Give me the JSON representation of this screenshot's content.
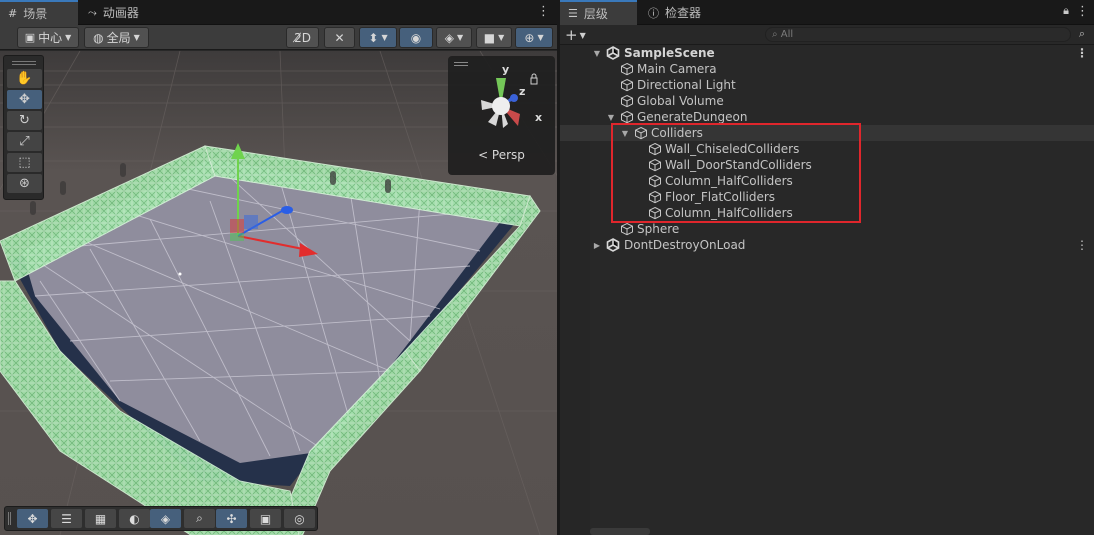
{
  "scene_panel": {
    "tabs": [
      {
        "label": "场景",
        "icon": "grid-icon",
        "active": true
      },
      {
        "label": "动画器",
        "icon": "animator-icon",
        "active": false
      }
    ],
    "toolbar": {
      "pivot_label": "中心",
      "space_label": "全局"
    },
    "tools": [
      "hand-tool",
      "move-tool",
      "rotate-tool",
      "scale-tool",
      "rect-tool",
      "transform-tool"
    ],
    "gizmo": {
      "y": "y",
      "z": "z",
      "x": "x",
      "projection": "< Persp"
    },
    "bottom_tools": [
      "move",
      "snap",
      "grid",
      "shading",
      "layers",
      "search",
      "pivot",
      "camera",
      "navigate"
    ]
  },
  "hierarchy_panel": {
    "tabs": [
      {
        "label": "层级",
        "icon": "list-icon",
        "active": true
      },
      {
        "label": "检查器",
        "icon": "info-icon",
        "active": false
      }
    ],
    "search_placeholder": "All",
    "items": [
      {
        "label": "SampleScene",
        "depth": 0,
        "type": "scene",
        "expanded": true
      },
      {
        "label": "Main Camera",
        "depth": 1,
        "type": "object"
      },
      {
        "label": "Directional Light",
        "depth": 1,
        "type": "object"
      },
      {
        "label": "Global Volume",
        "depth": 1,
        "type": "object"
      },
      {
        "label": "GenerateDungeon",
        "depth": 1,
        "type": "object",
        "expanded": true
      },
      {
        "label": "Colliders",
        "depth": 2,
        "type": "object",
        "expanded": true,
        "selected": true
      },
      {
        "label": "Wall_ChiseledColliders",
        "depth": 3,
        "type": "object"
      },
      {
        "label": "Wall_DoorStandColliders",
        "depth": 3,
        "type": "object"
      },
      {
        "label": "Column_HalfColliders",
        "depth": 3,
        "type": "object"
      },
      {
        "label": "Floor_FlatColliders",
        "depth": 3,
        "type": "object"
      },
      {
        "label": "Column_HalfColliders",
        "depth": 3,
        "type": "object"
      },
      {
        "label": "Sphere",
        "depth": 1,
        "type": "object"
      },
      {
        "label": "DontDestroyOnLoad",
        "depth": 0,
        "type": "scene",
        "expanded": false
      }
    ]
  }
}
